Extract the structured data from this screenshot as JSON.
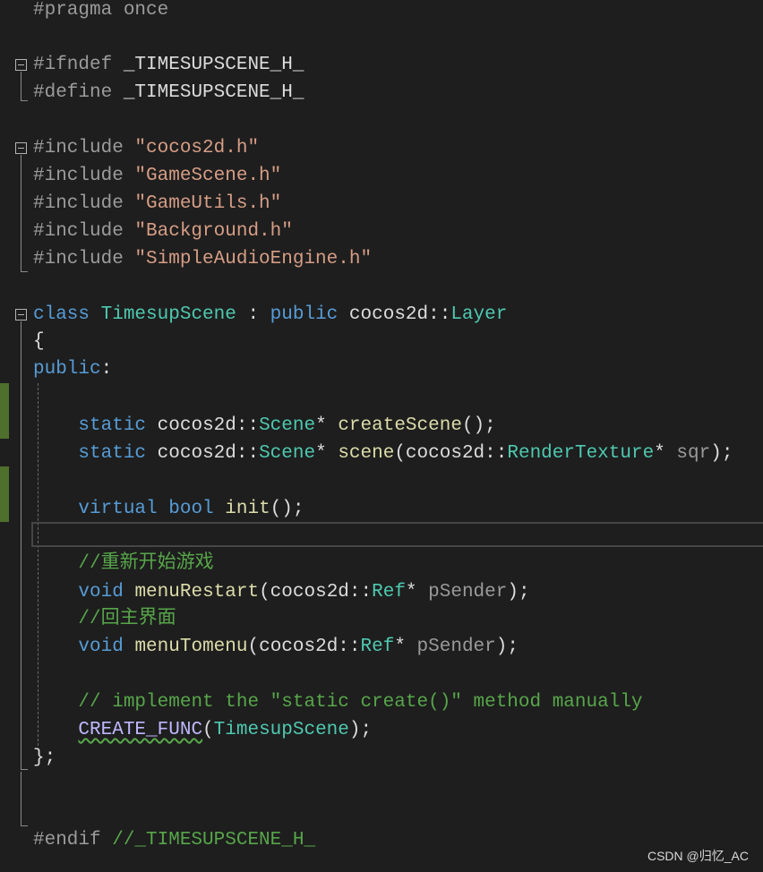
{
  "code": {
    "l1": {
      "pp": "#pragma once"
    },
    "l3": {
      "pp": "#ifndef ",
      "ident": "_TIMESUPSCENE_H_"
    },
    "l4": {
      "pp": "#define ",
      "ident": "_TIMESUPSCENE_H_"
    },
    "l6": {
      "pp": "#include ",
      "str": "\"cocos2d.h\""
    },
    "l7": {
      "pp": "#include ",
      "str": "\"GameScene.h\""
    },
    "l8": {
      "pp": "#include ",
      "str": "\"GameUtils.h\""
    },
    "l9": {
      "pp": "#include ",
      "str": "\"Background.h\""
    },
    "l10": {
      "pp": "#include ",
      "str": "\"SimpleAudioEngine.h\""
    },
    "l12": {
      "kw": "class",
      "name": "TimesupScene",
      "colon": " : ",
      "pub": "public",
      "ns": "cocos2d::",
      "base": "Layer"
    },
    "l13": {
      "brace": "{"
    },
    "l14": {
      "kw": "public",
      "colon": ":"
    },
    "l16": {
      "kw": "static",
      "ns": "cocos2d::",
      "type": "Scene",
      "star": "* ",
      "fn": "createScene",
      "rest": "();"
    },
    "l17": {
      "kw": "static",
      "ns": "cocos2d::",
      "type": "Scene",
      "star": "* ",
      "fn": "scene",
      "open": "(cocos2d::",
      "ptype": "RenderTexture",
      "pstar": "* ",
      "param": "sqr",
      "close": ");"
    },
    "l19": {
      "kw1": "virtual",
      "kw2": "bool",
      "fn": "init",
      "rest": "();"
    },
    "l21": {
      "cm": "//重新开始游戏"
    },
    "l22": {
      "kw": "void",
      "fn": "menuRestart",
      "open": "(cocos2d::",
      "ptype": "Ref",
      "pstar": "* ",
      "param": "pSender",
      "close": ");"
    },
    "l23": {
      "cm": "//回主界面"
    },
    "l24": {
      "kw": "void",
      "fn": "menuTomenu",
      "open": "(cocos2d::",
      "ptype": "Ref",
      "pstar": "* ",
      "param": "pSender",
      "close": ");"
    },
    "l26": {
      "cm": "// implement the \"static create()\" method manually"
    },
    "l27": {
      "macro": "CREATE_FUNC",
      "open": "(",
      "arg": "TimesupScene",
      "close": ");"
    },
    "l28": {
      "brace": "};"
    },
    "l32": {
      "pp": "#endif ",
      "cm": "//_TIMESUPSCENE_H_"
    }
  },
  "watermark": "CSDN @归忆_AC",
  "colors": {
    "background": "#1e1e1e",
    "keyword": "#569cd6",
    "type": "#4ec9b0",
    "function": "#dcdcaa",
    "string": "#d69d85",
    "comment": "#57a64a",
    "preprocessor": "#9b9b9b",
    "change_marker": "#4f6f2d"
  }
}
